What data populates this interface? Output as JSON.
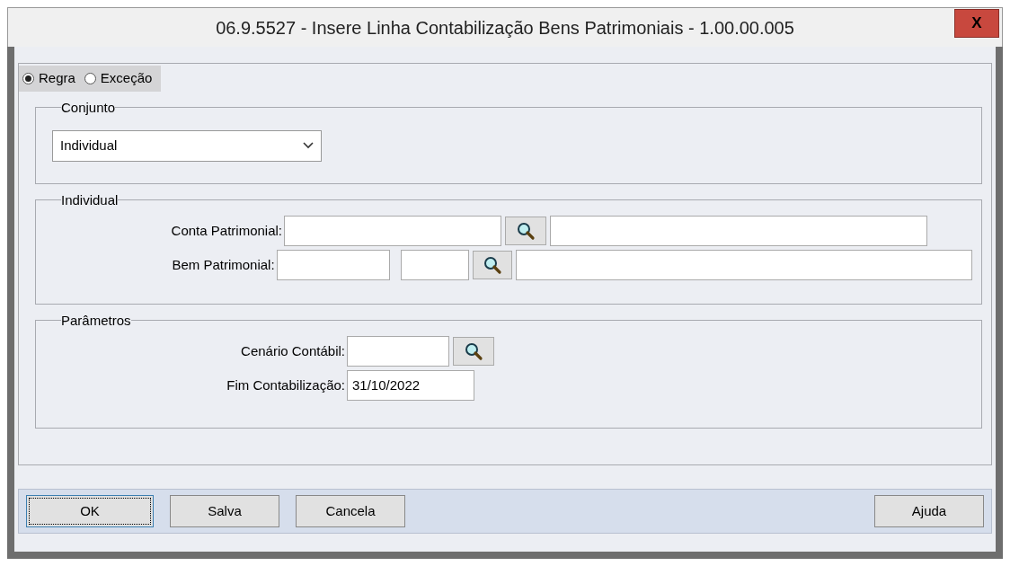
{
  "window": {
    "title": "06.9.5527 - Insere Linha Contabilização Bens Patrimoniais - 1.00.00.005",
    "close": "X"
  },
  "mode_options": [
    {
      "label": "Regra",
      "selected": true
    },
    {
      "label": "Exceção",
      "selected": false
    }
  ],
  "groups": [
    {
      "title": "Conjunto",
      "kind": "select",
      "value": "Individual"
    },
    {
      "title": "Individual",
      "kind": "fields",
      "rows": [
        {
          "label": "Conta Patrimonial:",
          "fields": [
            {
              "kind": "input"
            },
            {
              "kind": "lookup"
            },
            {
              "kind": "input"
            }
          ]
        },
        {
          "label": "Bem Patrimonial:",
          "fields": [
            {
              "kind": "input"
            },
            {
              "kind": "input"
            },
            {
              "kind": "lookup"
            },
            {
              "kind": "input"
            }
          ]
        }
      ]
    },
    {
      "title": "Parâmetros",
      "kind": "fields",
      "rows": [
        {
          "label": "Cenário Contábil:",
          "fields": [
            {
              "kind": "input"
            },
            {
              "kind": "lookup"
            }
          ]
        },
        {
          "label": "Fim Contabilização:",
          "fields": [
            {
              "kind": "input",
              "value": "31/10/2022"
            }
          ]
        }
      ]
    }
  ],
  "buttons": [
    {
      "label": "OK",
      "focused": true
    },
    {
      "label": "Salva",
      "focused": false
    },
    {
      "label": "Cancela",
      "focused": false
    },
    {
      "label": "Ajuda",
      "focused": false
    }
  ]
}
